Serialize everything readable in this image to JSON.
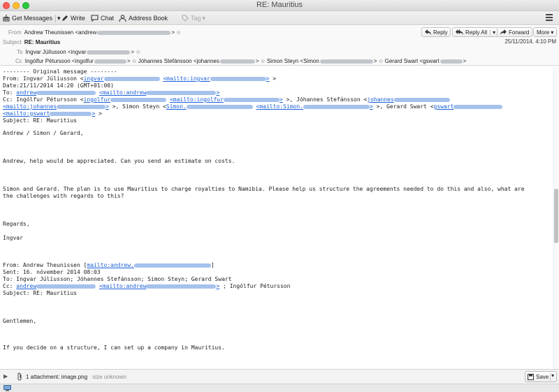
{
  "window": {
    "title": "RE: Mauritius"
  },
  "toolbar": {
    "get_messages": "Get Messages",
    "write": "Write",
    "chat": "Chat",
    "address_book": "Address Book",
    "tag": "Tag",
    "menu_icon": "hamburger-menu-icon"
  },
  "header": {
    "from_label": "From",
    "from_value": "Andrew Theunissen <andrew",
    "subject_label": "Subject",
    "subject_value": "RE: Mauritius",
    "to_label": "To",
    "to_value": "Ingvar Júlíusson <ingvar",
    "cc_label": "Cc",
    "cc_parts": [
      "Ingólfur Pétursson <ingolfur",
      "Jóhannes Stefánsson <johannes",
      "Simon Steyn <Simon",
      "Gerard Swart <gswart"
    ],
    "date": "25/11/2014, 4:10 PM",
    "reply": "Reply",
    "reply_all": "Reply All",
    "forward": "Forward",
    "more": "More"
  },
  "body": {
    "l1": "-------- Original message --------",
    "l2a": "From: Ingvar Júlíusson <",
    "l2b": "ingvar",
    "l2c": "mailto:ingvar",
    "l3": "Date:21/11/2014 14:20 (GMT+01:00)",
    "l4a": "To: ",
    "l4b": "andrew",
    "l4c": "mailto:andrew",
    "l5a": "Cc: Ingólfur Pétursson <",
    "l5b": "ingolfur",
    "l5c": "mailto:ingolfur",
    "l5d": " >, Jóhannes Stefánsson <",
    "l5e": "johannes",
    "l6a": "mailto:johannes",
    "l6b": " >, Simon Steyn <",
    "l6c": "Simon.",
    "l6d": "mailto:Simon.",
    "l6e": " >, Gerard Swart <",
    "l6f": "gswart",
    "l7a": "mailto:gswart",
    "l8": "Subject: RE: Mauritius",
    "p1": "Andrew / Simon / Gerard,",
    "p2": "Andrew, help would be appreciated. Can you send an estimate on costs.",
    "p3a": "Simon and Gerard. The plan is to use Mauritius to charge royalties to Namibia. Please help us structure the agreements needed to do this and also, what are",
    "p3b": "the challenges with regards to this?",
    "p4": "Regards,",
    "p5": "Ingvar",
    "q1a": "From: Andrew Theunissen [",
    "q1b": "mailto:andrew.",
    "q2": "Sent: 16. nóvember 2014 08:03",
    "q3": "To: Ingvar Júlíusson; Jóhannes Stefánsson; Simon Steyn; Gerard Swart",
    "q4a": "Cc: ",
    "q4b": "andrew",
    "q4c": "mailto:andrew",
    "q4d": " ; Ingólfur Pétursson",
    "q5": "Subject: RE: Mauritius",
    "q6": "Gentlemen,",
    "q7": "If you decide on a structure, I can set up a company in Mauritius."
  },
  "attachments": {
    "summary": "1 attachment: image.png",
    "size": "size unknown",
    "save": "Save"
  }
}
